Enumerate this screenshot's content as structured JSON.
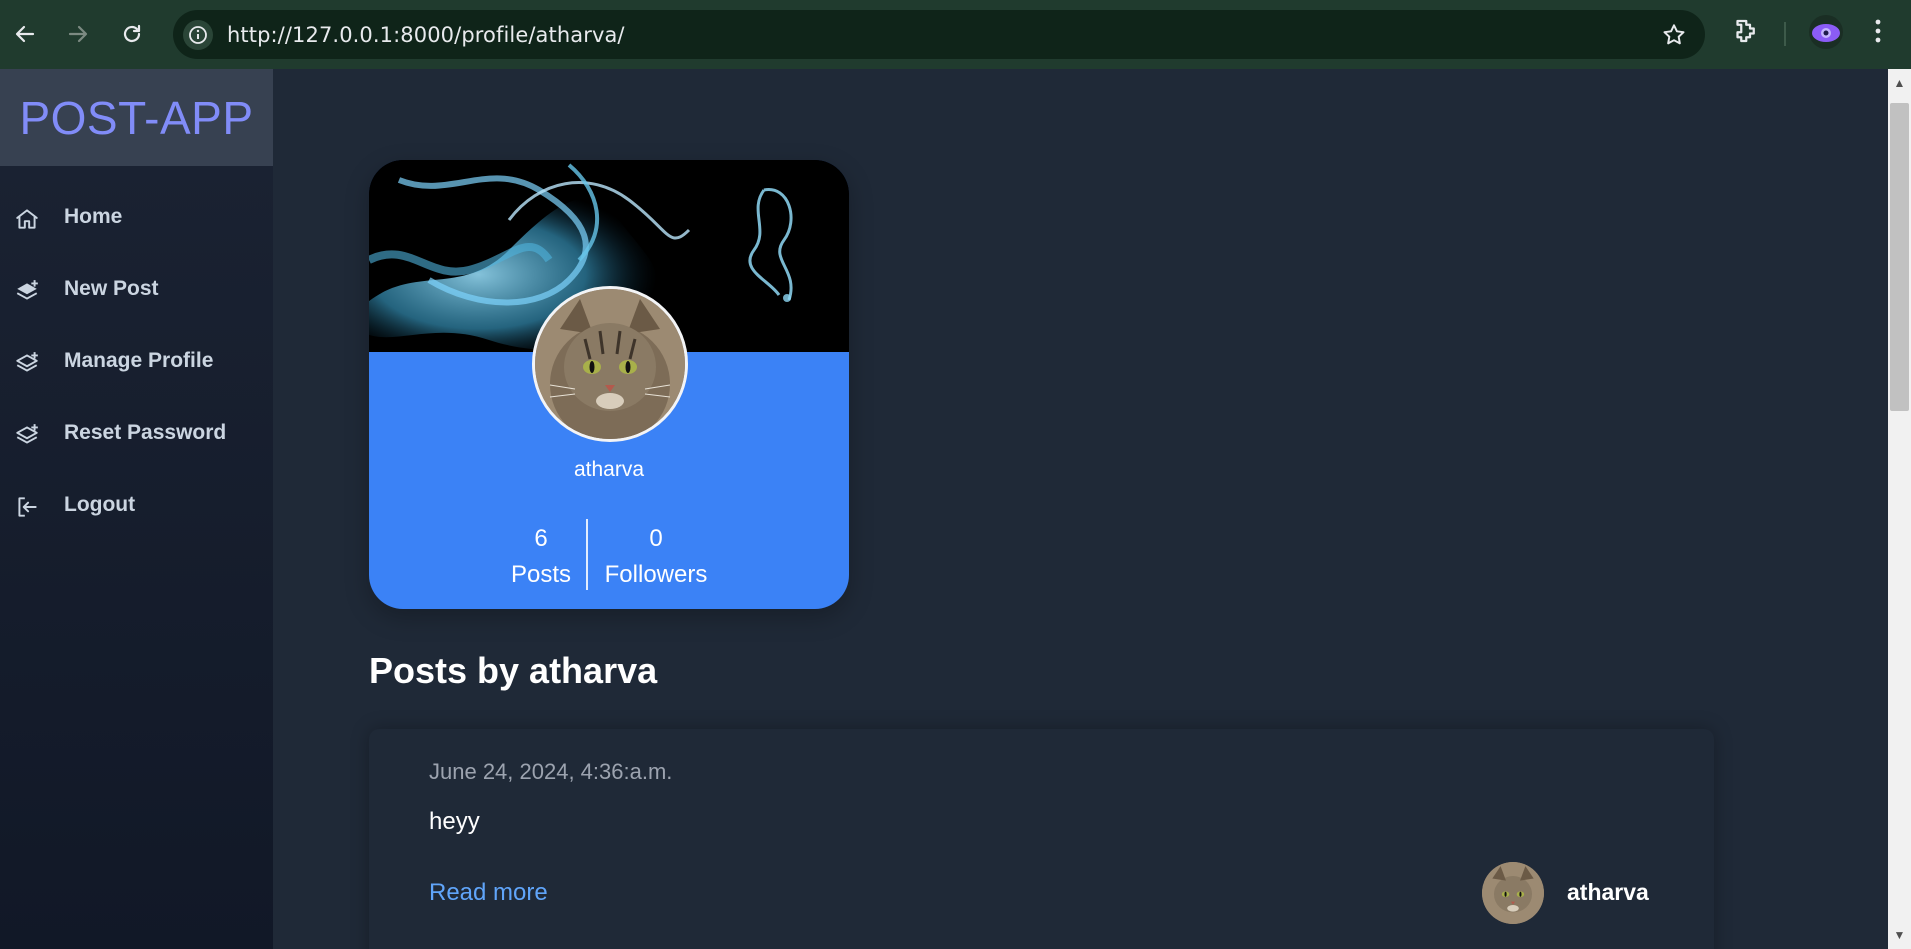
{
  "browser": {
    "url": "http://127.0.0.1:8000/profile/atharva/"
  },
  "sidebar": {
    "brand": "POST-APP",
    "items": [
      {
        "label": "Home",
        "icon": "home-icon"
      },
      {
        "label": "New Post",
        "icon": "layers-plus-icon"
      },
      {
        "label": "Manage Profile",
        "icon": "layers-plus-icon"
      },
      {
        "label": "Reset Password",
        "icon": "layers-plus-icon"
      },
      {
        "label": "Logout",
        "icon": "logout-icon"
      }
    ]
  },
  "profile": {
    "username": "atharva",
    "posts_count": "6",
    "posts_label": "Posts",
    "followers_count": "0",
    "followers_label": "Followers"
  },
  "posts_section": {
    "heading": "Posts by atharva",
    "posts": [
      {
        "date": "June 24, 2024, 4:36:a.m.",
        "text": "heyy",
        "read_more": "Read more",
        "author": "atharva"
      }
    ]
  },
  "colors": {
    "accent": "#3b82f6",
    "brand": "#818cf8",
    "link": "#60a5fa",
    "background": "#1f2937",
    "sidebar": "#111827"
  }
}
